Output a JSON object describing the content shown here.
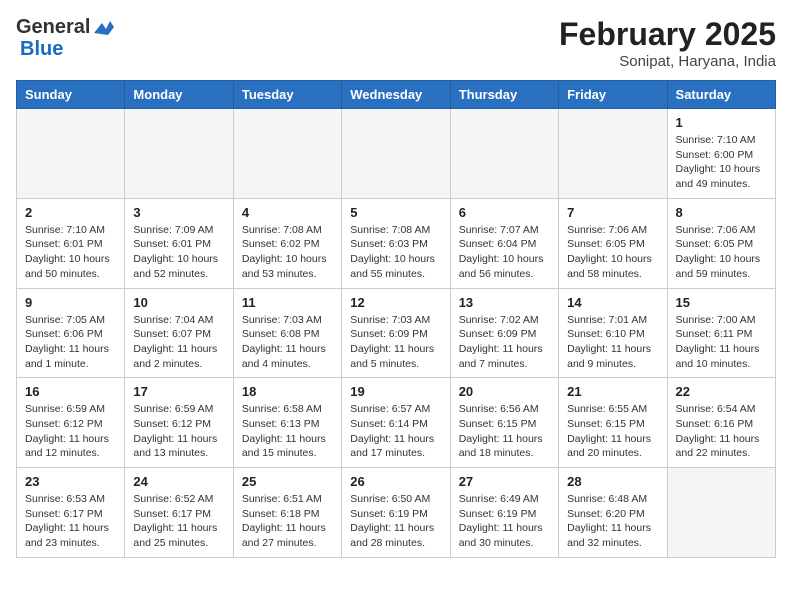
{
  "header": {
    "logo_general": "General",
    "logo_blue": "Blue",
    "month_title": "February 2025",
    "location": "Sonipat, Haryana, India"
  },
  "days_of_week": [
    "Sunday",
    "Monday",
    "Tuesday",
    "Wednesday",
    "Thursday",
    "Friday",
    "Saturday"
  ],
  "weeks": [
    [
      {
        "day": "",
        "info": ""
      },
      {
        "day": "",
        "info": ""
      },
      {
        "day": "",
        "info": ""
      },
      {
        "day": "",
        "info": ""
      },
      {
        "day": "",
        "info": ""
      },
      {
        "day": "",
        "info": ""
      },
      {
        "day": "1",
        "info": "Sunrise: 7:10 AM\nSunset: 6:00 PM\nDaylight: 10 hours and 49 minutes."
      }
    ],
    [
      {
        "day": "2",
        "info": "Sunrise: 7:10 AM\nSunset: 6:01 PM\nDaylight: 10 hours and 50 minutes."
      },
      {
        "day": "3",
        "info": "Sunrise: 7:09 AM\nSunset: 6:01 PM\nDaylight: 10 hours and 52 minutes."
      },
      {
        "day": "4",
        "info": "Sunrise: 7:08 AM\nSunset: 6:02 PM\nDaylight: 10 hours and 53 minutes."
      },
      {
        "day": "5",
        "info": "Sunrise: 7:08 AM\nSunset: 6:03 PM\nDaylight: 10 hours and 55 minutes."
      },
      {
        "day": "6",
        "info": "Sunrise: 7:07 AM\nSunset: 6:04 PM\nDaylight: 10 hours and 56 minutes."
      },
      {
        "day": "7",
        "info": "Sunrise: 7:06 AM\nSunset: 6:05 PM\nDaylight: 10 hours and 58 minutes."
      },
      {
        "day": "8",
        "info": "Sunrise: 7:06 AM\nSunset: 6:05 PM\nDaylight: 10 hours and 59 minutes."
      }
    ],
    [
      {
        "day": "9",
        "info": "Sunrise: 7:05 AM\nSunset: 6:06 PM\nDaylight: 11 hours and 1 minute."
      },
      {
        "day": "10",
        "info": "Sunrise: 7:04 AM\nSunset: 6:07 PM\nDaylight: 11 hours and 2 minutes."
      },
      {
        "day": "11",
        "info": "Sunrise: 7:03 AM\nSunset: 6:08 PM\nDaylight: 11 hours and 4 minutes."
      },
      {
        "day": "12",
        "info": "Sunrise: 7:03 AM\nSunset: 6:09 PM\nDaylight: 11 hours and 5 minutes."
      },
      {
        "day": "13",
        "info": "Sunrise: 7:02 AM\nSunset: 6:09 PM\nDaylight: 11 hours and 7 minutes."
      },
      {
        "day": "14",
        "info": "Sunrise: 7:01 AM\nSunset: 6:10 PM\nDaylight: 11 hours and 9 minutes."
      },
      {
        "day": "15",
        "info": "Sunrise: 7:00 AM\nSunset: 6:11 PM\nDaylight: 11 hours and 10 minutes."
      }
    ],
    [
      {
        "day": "16",
        "info": "Sunrise: 6:59 AM\nSunset: 6:12 PM\nDaylight: 11 hours and 12 minutes."
      },
      {
        "day": "17",
        "info": "Sunrise: 6:59 AM\nSunset: 6:12 PM\nDaylight: 11 hours and 13 minutes."
      },
      {
        "day": "18",
        "info": "Sunrise: 6:58 AM\nSunset: 6:13 PM\nDaylight: 11 hours and 15 minutes."
      },
      {
        "day": "19",
        "info": "Sunrise: 6:57 AM\nSunset: 6:14 PM\nDaylight: 11 hours and 17 minutes."
      },
      {
        "day": "20",
        "info": "Sunrise: 6:56 AM\nSunset: 6:15 PM\nDaylight: 11 hours and 18 minutes."
      },
      {
        "day": "21",
        "info": "Sunrise: 6:55 AM\nSunset: 6:15 PM\nDaylight: 11 hours and 20 minutes."
      },
      {
        "day": "22",
        "info": "Sunrise: 6:54 AM\nSunset: 6:16 PM\nDaylight: 11 hours and 22 minutes."
      }
    ],
    [
      {
        "day": "23",
        "info": "Sunrise: 6:53 AM\nSunset: 6:17 PM\nDaylight: 11 hours and 23 minutes."
      },
      {
        "day": "24",
        "info": "Sunrise: 6:52 AM\nSunset: 6:17 PM\nDaylight: 11 hours and 25 minutes."
      },
      {
        "day": "25",
        "info": "Sunrise: 6:51 AM\nSunset: 6:18 PM\nDaylight: 11 hours and 27 minutes."
      },
      {
        "day": "26",
        "info": "Sunrise: 6:50 AM\nSunset: 6:19 PM\nDaylight: 11 hours and 28 minutes."
      },
      {
        "day": "27",
        "info": "Sunrise: 6:49 AM\nSunset: 6:19 PM\nDaylight: 11 hours and 30 minutes."
      },
      {
        "day": "28",
        "info": "Sunrise: 6:48 AM\nSunset: 6:20 PM\nDaylight: 11 hours and 32 minutes."
      },
      {
        "day": "",
        "info": ""
      }
    ]
  ]
}
